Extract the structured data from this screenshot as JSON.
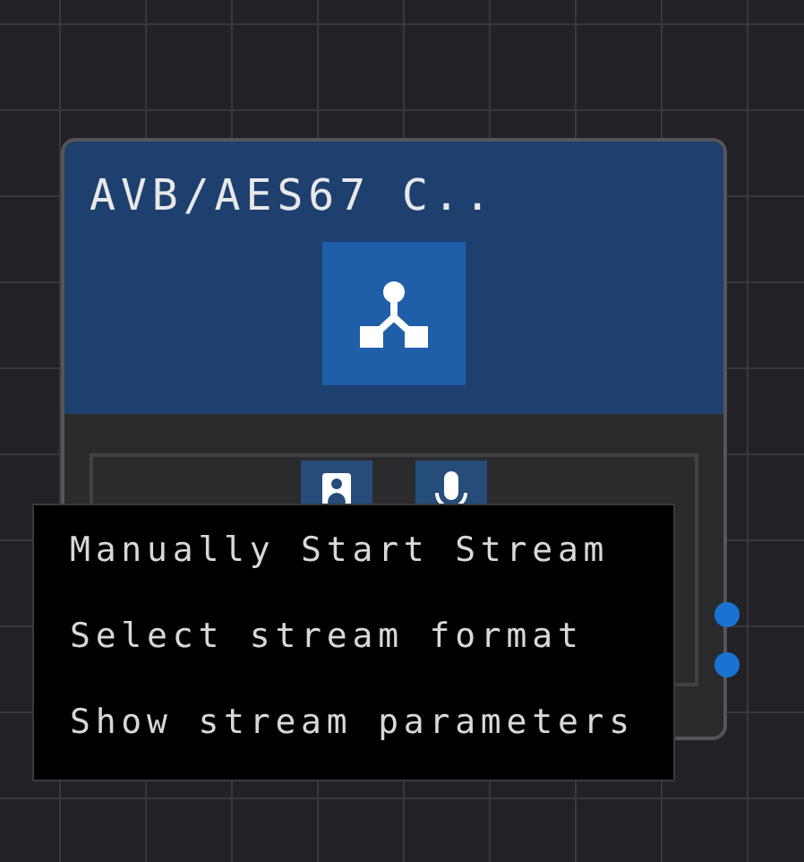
{
  "node": {
    "title": "AVB/AES67 C.."
  },
  "context_menu": {
    "items": [
      {
        "label": "Manually Start Stream"
      },
      {
        "label": "Select stream format"
      },
      {
        "label": "Show stream parameters"
      }
    ]
  }
}
